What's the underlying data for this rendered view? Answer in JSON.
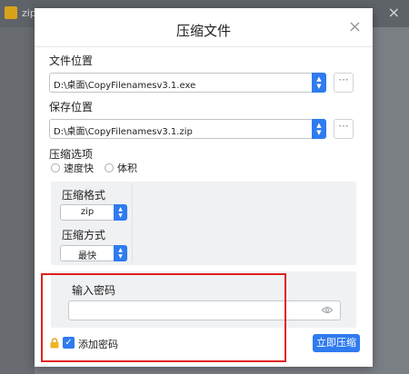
{
  "background": {
    "app_title": "zip"
  },
  "dialog": {
    "title": "压缩文件",
    "close_glyph": "×",
    "file_location_label": "文件位置",
    "file_location_value": "D:\\桌面\\CopyFilenamesv3.1.exe",
    "save_location_label": "保存位置",
    "save_location_value": "D:\\桌面\\CopyFilenamesv3.1.zip",
    "browse_glyph": "···",
    "options_label": "压缩选项",
    "radio_options": [
      "速度快",
      "体积"
    ],
    "format_label": "压缩格式",
    "format_value": "zip",
    "method_label": "压缩方式",
    "method_value": "最快",
    "password_label": "输入密码",
    "password_value": "",
    "add_password_label": "添加密码",
    "add_password_checked": true,
    "submit_label": "立即压缩"
  },
  "colors": {
    "accent": "#2f7bf0",
    "highlight": "#e02020"
  }
}
